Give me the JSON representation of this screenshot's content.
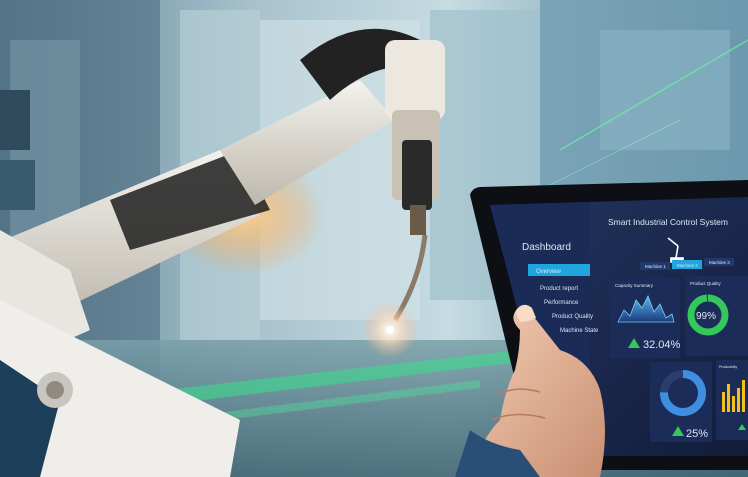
{
  "dashboard": {
    "system_title": "Smart Industrial Control System",
    "sidebar_title": "Dashboard",
    "nav_items": [
      "Overview",
      "Product report",
      "Performance",
      "Product Quality",
      "Machine State"
    ],
    "machine_tabs": [
      "Machine 1",
      "Machine 2",
      "Machine 3"
    ],
    "widgets": {
      "capacity_title": "Capacity Summary",
      "capacity_value": "32.04%",
      "quality_title": "Product Quality",
      "quality_value": "99%",
      "quality_fraction": 0.99,
      "ring_value": "25%",
      "ring_fraction": 0.25,
      "chart2_title": "Productivity"
    }
  },
  "colors": {
    "accent": "#1fa6df",
    "green": "#34c759",
    "dark_panel": "#16244a",
    "bar_yellow": "#f2c21b"
  }
}
